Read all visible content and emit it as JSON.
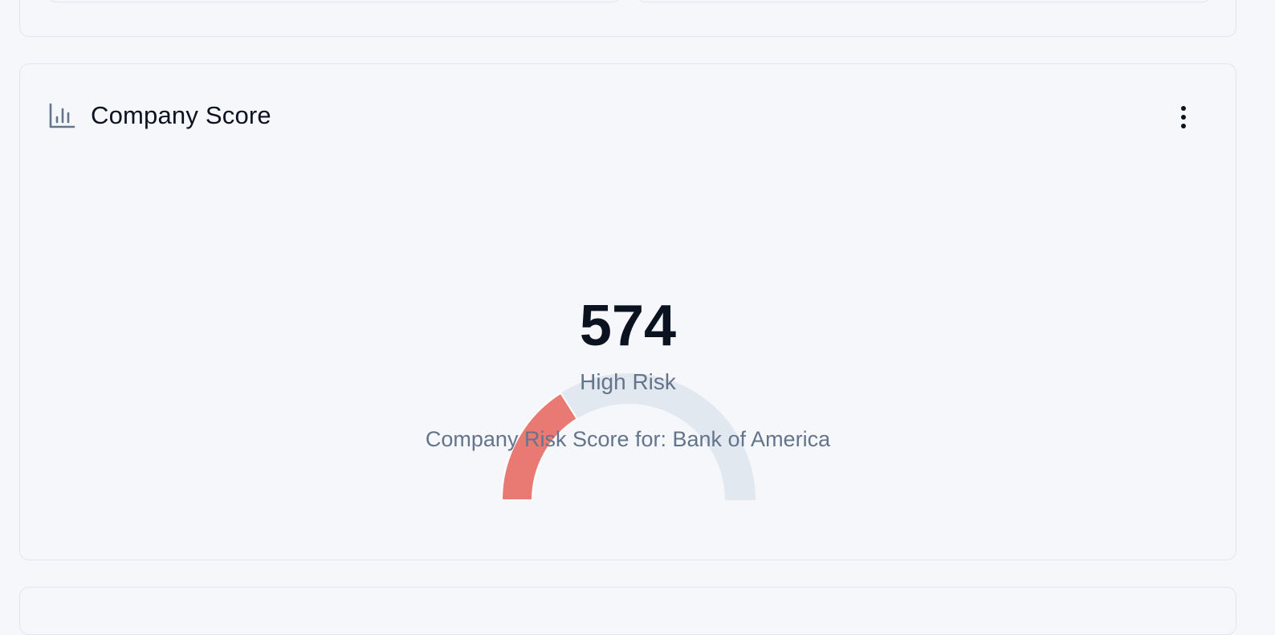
{
  "card": {
    "title": "Company Score",
    "icon": "bar-chart-icon",
    "menu_icon": "more-vertical-icon"
  },
  "score": {
    "value": "574",
    "label": "High Risk",
    "caption": "Company Risk Score for: Bank of America",
    "fraction": 0.32
  },
  "colors": {
    "gauge_fill": "#e97a73",
    "gauge_track": "#e2e8f0"
  }
}
